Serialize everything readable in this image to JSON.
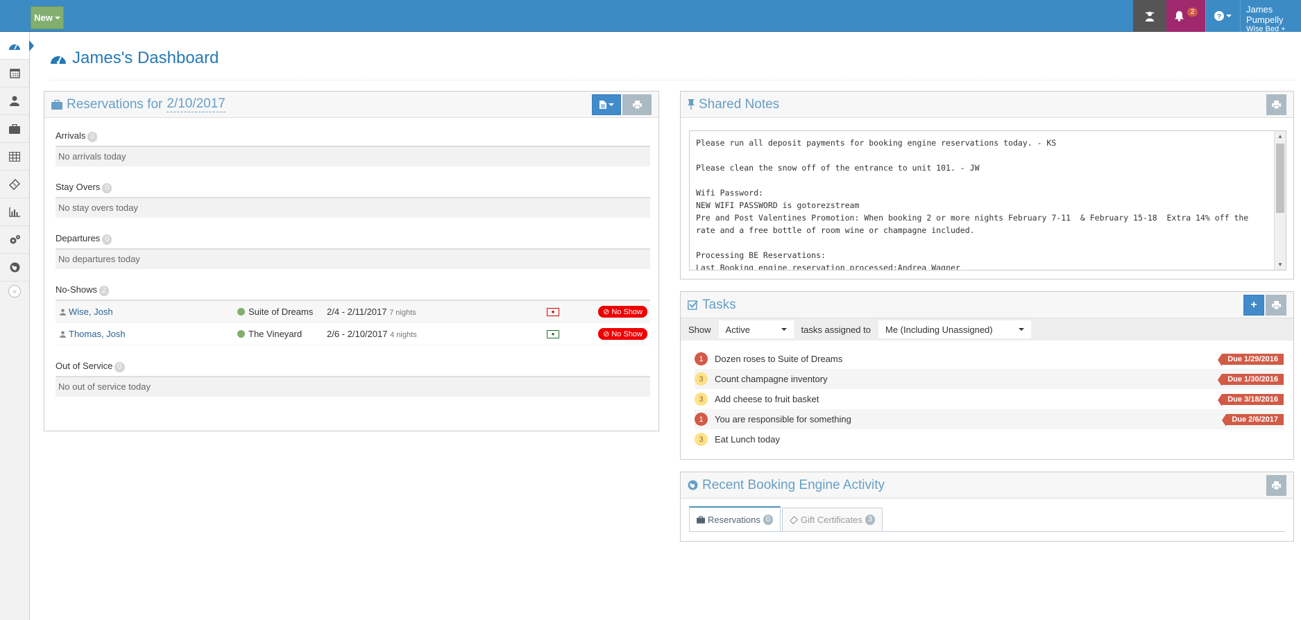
{
  "topbar": {
    "new_label": "New",
    "notifications_count": "2",
    "user_name": "James Pumpelly",
    "user_property": "Wise Bed + Breakf..",
    "accent": "#3d8bc4"
  },
  "sidebar": {
    "items": [
      "dashboard-icon",
      "calendar-icon",
      "user-icon",
      "briefcase-icon",
      "table-icon",
      "ticket-icon",
      "bar-chart-icon",
      "cogs-icon",
      "globe-icon"
    ],
    "collapse_label": "»"
  },
  "page": {
    "title": "James's Dashboard"
  },
  "reservations": {
    "title": "Reservations for",
    "date": "2/10/2017",
    "arrivals": {
      "label": "Arrivals",
      "count": "0",
      "empty": "No arrivals today"
    },
    "stayovers": {
      "label": "Stay Overs",
      "count": "0",
      "empty": "No stay overs today"
    },
    "departures": {
      "label": "Departures",
      "count": "0",
      "empty": "No departures today"
    },
    "noshows": {
      "label": "No-Shows",
      "count": "2",
      "rows": [
        {
          "name": "Wise, Josh",
          "unit": "Suite of Dreams",
          "dates": "2/4 - 2/11/2017",
          "nights": "7 nights",
          "badge": "No Show"
        },
        {
          "name": "Thomas, Josh",
          "unit": "The Vineyard",
          "dates": "2/6 - 2/10/2017",
          "nights": "4 nights",
          "badge": "No Show"
        }
      ]
    },
    "outofservice": {
      "label": "Out of Service",
      "count": "0",
      "empty": "No out of service today"
    }
  },
  "notes": {
    "title": "Shared Notes",
    "text": "Please run all deposit payments for booking engine reservations today. - KS\n\nPlease clean the snow off of the entrance to unit 101. - JW\n\nWifi Password:\nNEW WIFI PASSWORD is gotorezstream\nPre and Post Valentines Promotion: When booking 2 or more nights February 7-11  & February 15-18  Extra 14% off the rate and a free bottle of room wine or champagne included.\n\nProcessing BE Reservations:\nLast Booking engine reservation processed:Andrea Wagner"
  },
  "tasks": {
    "title": "Tasks",
    "show_label": "Show",
    "show_value": "Active",
    "assigned_label": "tasks assigned to",
    "assigned_value": "Me (Including Unassigned)",
    "items": [
      {
        "priority": "1",
        "text": "Dozen roses to Suite of Dreams",
        "due": "Due 1/29/2016"
      },
      {
        "priority": "3",
        "text": "Count champagne inventory",
        "due": "Due 1/30/2016"
      },
      {
        "priority": "3",
        "text": "Add cheese to fruit basket",
        "due": "Due 3/18/2016"
      },
      {
        "priority": "1",
        "text": "You are responsible for something",
        "due": "Due 2/6/2017"
      },
      {
        "priority": "3",
        "text": "Eat Lunch today",
        "due": ""
      }
    ]
  },
  "activity": {
    "title": "Recent Booking Engine Activity",
    "tabs": [
      {
        "label": "Reservations",
        "count": "0"
      },
      {
        "label": "Gift Certificates",
        "count": "3"
      }
    ]
  }
}
